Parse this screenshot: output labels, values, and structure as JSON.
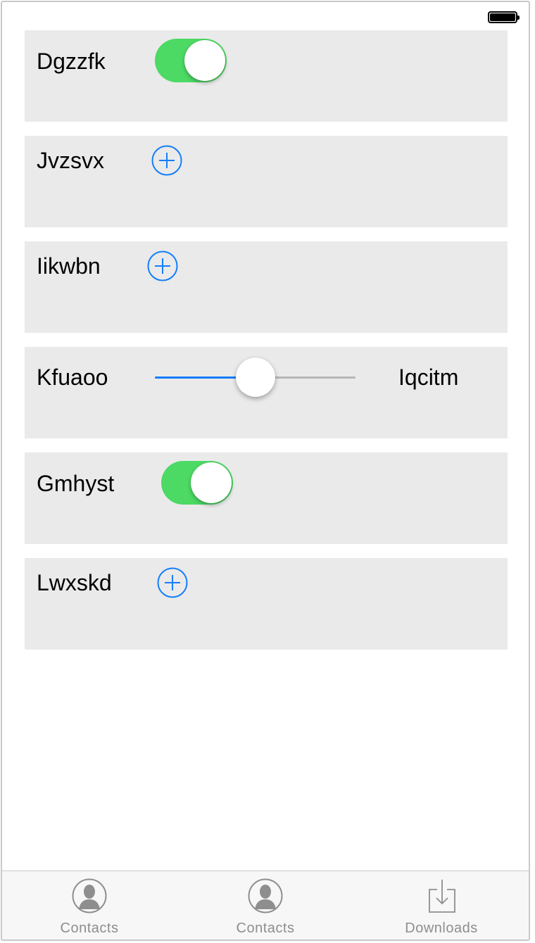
{
  "status_bar": {
    "battery_icon": "battery-full-icon"
  },
  "rows": [
    {
      "label": "Dgzzfk",
      "control": "toggle",
      "on": true
    },
    {
      "label": "Jvzsvx",
      "control": "add-button",
      "icon": "plus-circle-icon"
    },
    {
      "label": "Iikwbn",
      "control": "add-button",
      "icon": "plus-circle-icon"
    },
    {
      "label": "Kfuaoo",
      "control": "slider",
      "value_fraction": 0.5,
      "right_label": "Iqcitm"
    },
    {
      "label": "Gmhyst",
      "control": "toggle",
      "on": true
    },
    {
      "label": "Lwxskd",
      "control": "add-button",
      "icon": "plus-circle-icon"
    }
  ],
  "tab_bar": {
    "tabs": [
      {
        "label": "Contacts",
        "icon": "contact-person-icon"
      },
      {
        "label": "Contacts",
        "icon": "contact-person-icon"
      },
      {
        "label": "Downloads",
        "icon": "download-tray-icon"
      }
    ]
  },
  "colors": {
    "toggle_on": "#4cd964",
    "accent_blue": "#147efb",
    "card_background": "#eaeaea",
    "tab_label": "#8e8e8e"
  }
}
